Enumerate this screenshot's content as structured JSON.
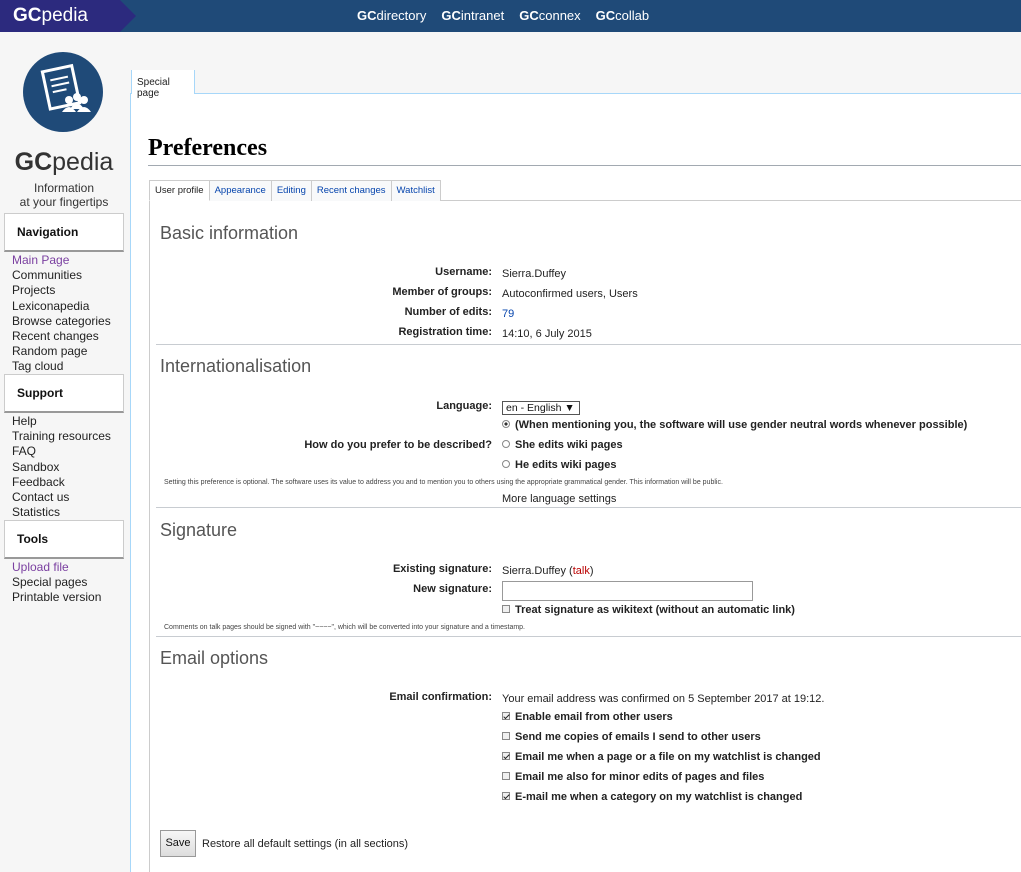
{
  "topbar": {
    "brand": {
      "bold": "GC",
      "rest": "pedia"
    },
    "links": [
      {
        "gc": "GC",
        "rest": "directory"
      },
      {
        "gc": "GC",
        "rest": "intranet"
      },
      {
        "gc": "GC",
        "rest": "connex"
      },
      {
        "gc": "GC",
        "rest": "collab"
      }
    ]
  },
  "logo": {
    "word_bold": "GC",
    "word_rest": "pedia",
    "tagline_1": "Information",
    "tagline_2": "at your fingertips"
  },
  "sidebar": {
    "navigation": {
      "title": "Navigation",
      "items": [
        "Main Page",
        "Communities",
        "Projects",
        "Lexiconapedia",
        "Browse categories",
        "Recent changes",
        "Random page",
        "Tag cloud"
      ]
    },
    "support": {
      "title": "Support",
      "items": [
        "Help",
        "Training resources",
        "FAQ",
        "Sandbox",
        "Feedback",
        "Contact us",
        "Statistics"
      ]
    },
    "tools": {
      "title": "Tools",
      "items": [
        "Upload file",
        "Special pages",
        "Printable version"
      ]
    }
  },
  "page": {
    "tab": "Special page",
    "title": "Preferences",
    "pref_tabs": [
      "User profile",
      "Appearance",
      "Editing",
      "Recent changes",
      "Watchlist"
    ]
  },
  "basic": {
    "title": "Basic information",
    "username_label": "Username:",
    "username": "Sierra.Duffey",
    "groups_label": "Member of groups:",
    "groups": "Autoconfirmed users, Users",
    "edits_label": "Number of edits:",
    "edits": "79",
    "reg_label": "Registration time:",
    "reg": "14:10, 6 July 2015"
  },
  "intl": {
    "title": "Internationalisation",
    "language_label": "Language:",
    "language_value": "en - English",
    "gender_label": "How do you prefer to be described?",
    "gender_options": [
      "(When mentioning you, the software will use gender neutral words whenever possible)",
      "She edits wiki pages",
      "He edits wiki pages"
    ],
    "gender_help": "Setting this preference is optional. The software uses its value to address you and to mention you to others using the appropriate grammatical gender. This information will be public.",
    "more_lang": "More language settings"
  },
  "signature": {
    "title": "Signature",
    "existing_label": "Existing signature:",
    "existing_name": "Sierra.Duffey",
    "existing_talk": "talk",
    "new_label": "New signature:",
    "new_value": "",
    "wikitext_label": "Treat signature as wikitext (without an automatic link)",
    "help": "Comments on talk pages should be signed with \"~~~~\", which will be converted into your signature and a timestamp."
  },
  "email": {
    "title": "Email options",
    "confirm_label": "Email confirmation:",
    "confirm_text": "Your email address was confirmed on 5 September 2017 at 19:12.",
    "options": [
      {
        "label": "Enable email from other users",
        "checked": true
      },
      {
        "label": "Send me copies of emails I send to other users",
        "checked": false
      },
      {
        "label": "Email me when a page or a file on my watchlist is changed",
        "checked": true
      },
      {
        "label": "Email me also for minor edits of pages and files",
        "checked": false
      },
      {
        "label": "E-mail me when a category on my watchlist is changed",
        "checked": true
      }
    ]
  },
  "footer": {
    "save": "Save",
    "restore": "Restore all default settings (in all sections)"
  }
}
